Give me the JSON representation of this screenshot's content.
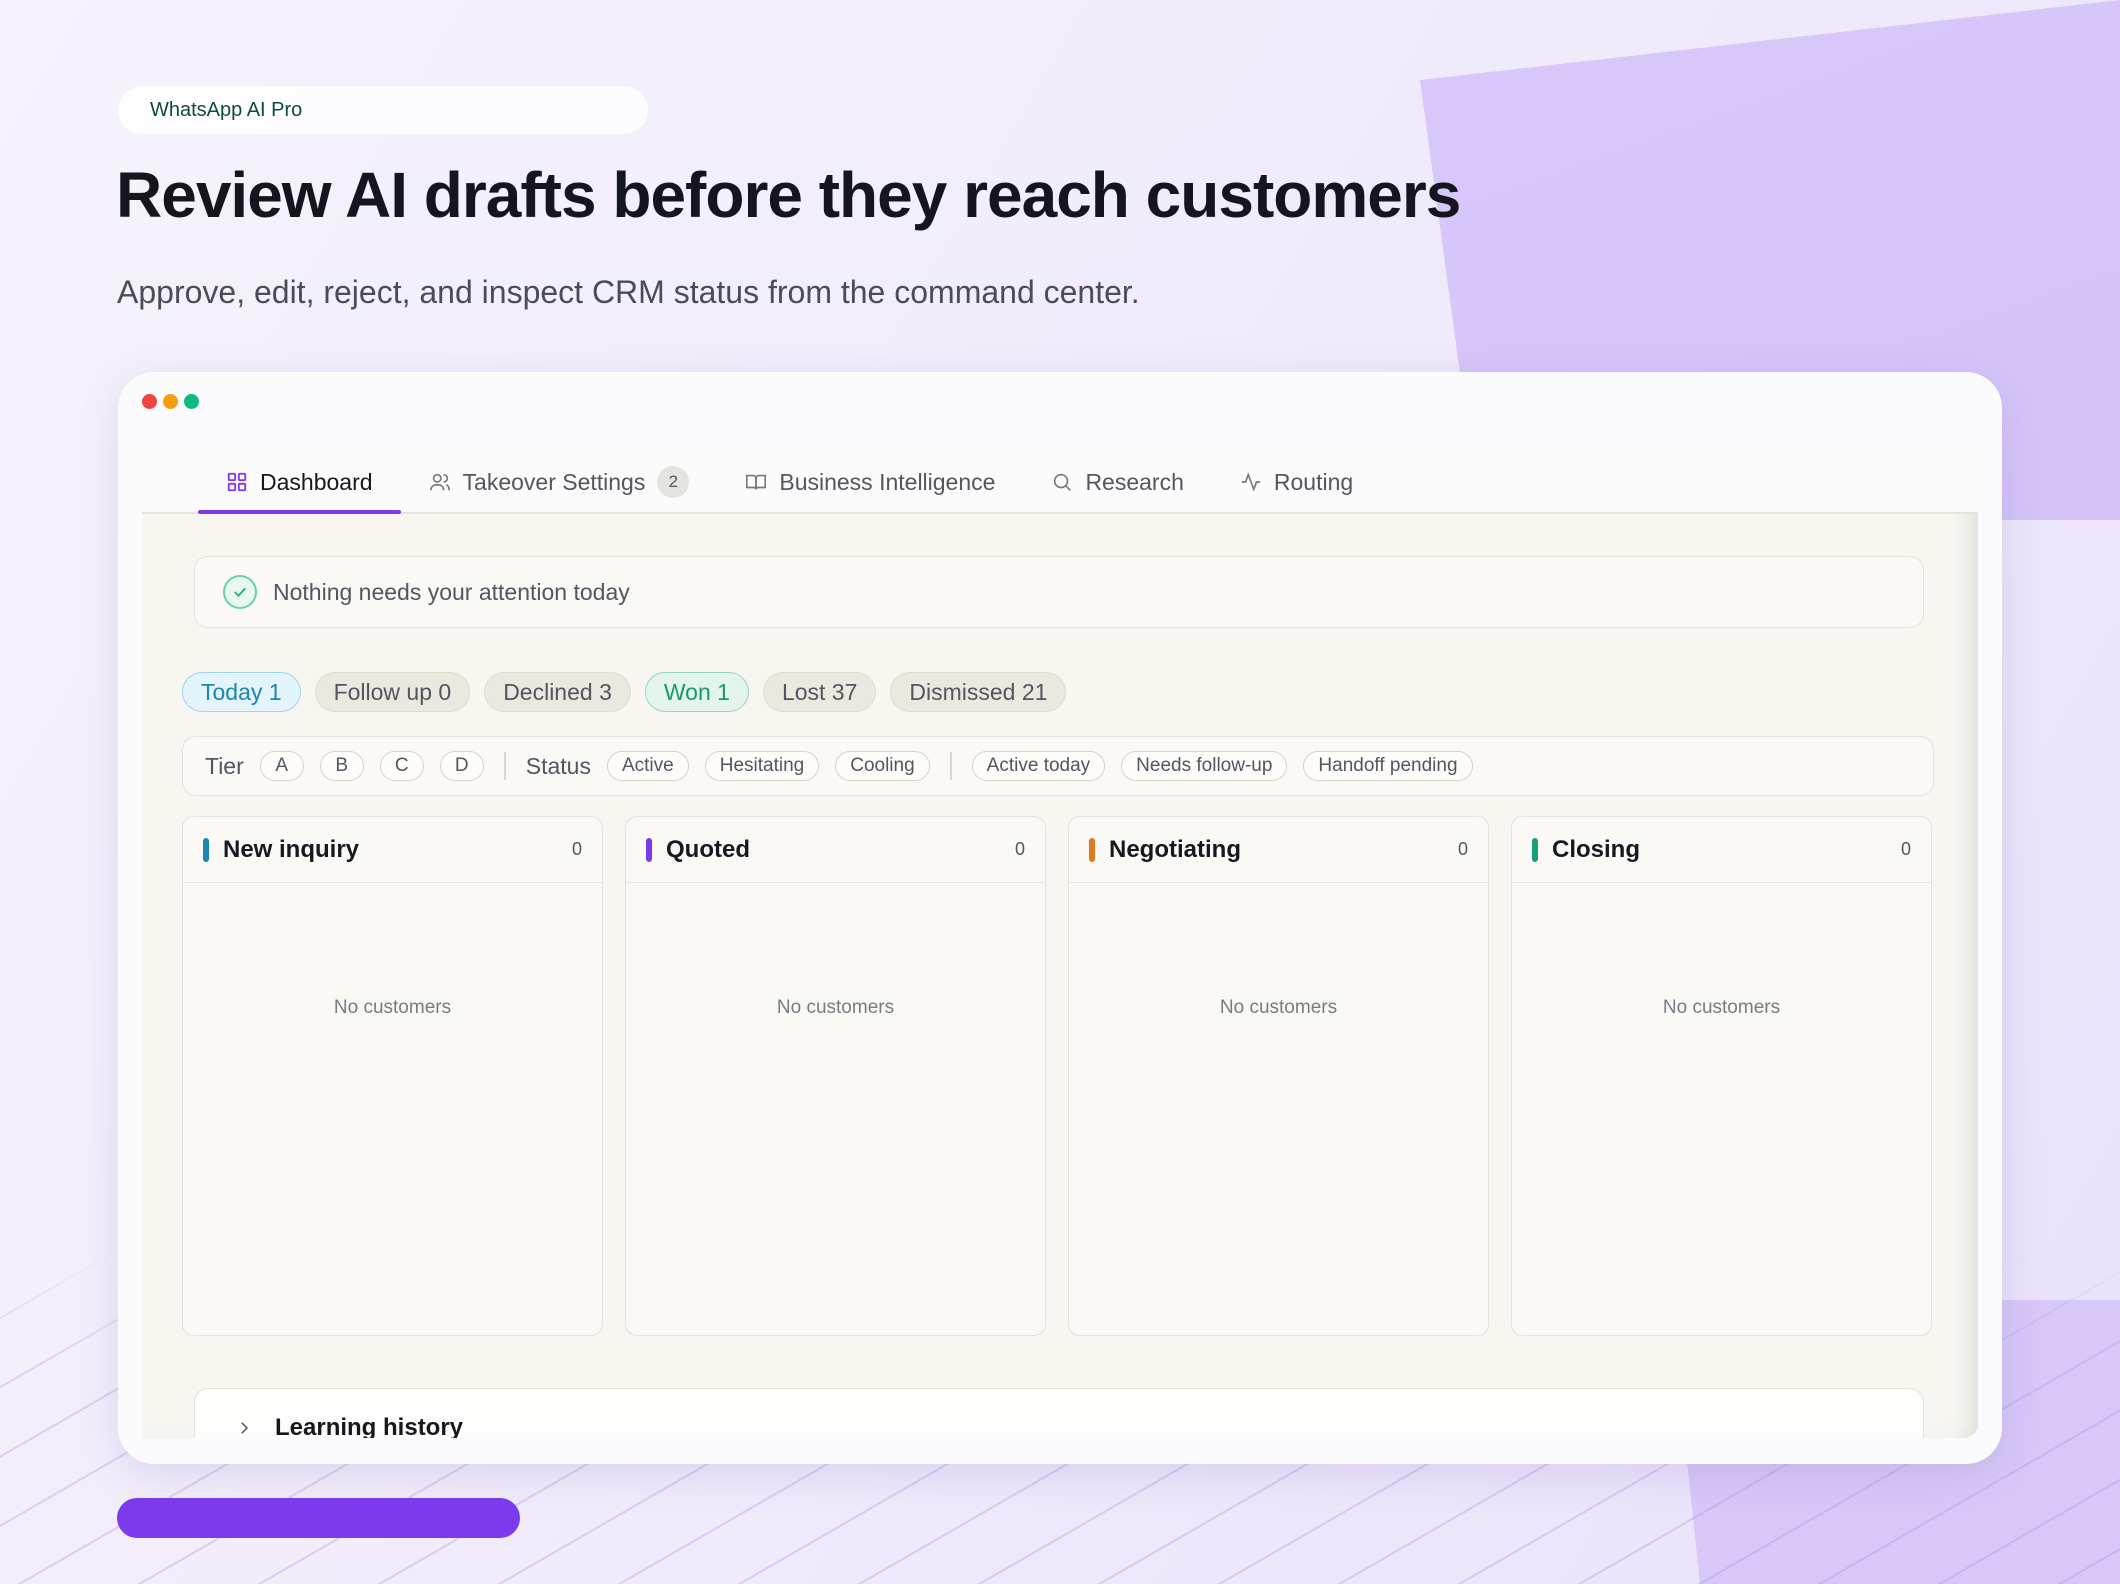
{
  "badge": "WhatsApp AI Pro",
  "headline": "Review AI drafts before they reach customers",
  "subhead": "Approve, edit, reject, and inspect CRM status from the command center.",
  "colors": {
    "accent": "#7c3aed",
    "window_dots": [
      "#ef4444",
      "#f59e0b",
      "#10b981"
    ],
    "column_bars": [
      "#1a88b4",
      "#7c3aed",
      "#e07a1c",
      "#17a079"
    ]
  },
  "tabs": [
    {
      "label": "Dashboard",
      "icon": "grid-icon",
      "active": true
    },
    {
      "label": "Takeover Settings",
      "icon": "users-icon",
      "badge": "2"
    },
    {
      "label": "Business Intelligence",
      "icon": "book-icon"
    },
    {
      "label": "Research",
      "icon": "search-icon"
    },
    {
      "label": "Routing",
      "icon": "activity-icon"
    }
  ],
  "notice": "Nothing needs your attention today",
  "filters": [
    "Today 1",
    "Follow up 0",
    "Declined 3",
    "Won 1",
    "Lost 37",
    "Dismissed 21"
  ],
  "tier": {
    "label": "Tier",
    "options": [
      "A",
      "B",
      "C",
      "D"
    ],
    "status_label": "Status",
    "status_options": [
      "Active",
      "Hesitating",
      "Cooling"
    ],
    "extra_options": [
      "Active today",
      "Needs follow-up",
      "Handoff pending"
    ]
  },
  "columns": [
    {
      "title": "New inquiry",
      "count": "0",
      "empty": "No customers"
    },
    {
      "title": "Quoted",
      "count": "0",
      "empty": "No customers"
    },
    {
      "title": "Negotiating",
      "count": "0",
      "empty": "No customers"
    },
    {
      "title": "Closing",
      "count": "0",
      "empty": "No customers"
    }
  ],
  "learning": {
    "title": "Learning history"
  }
}
